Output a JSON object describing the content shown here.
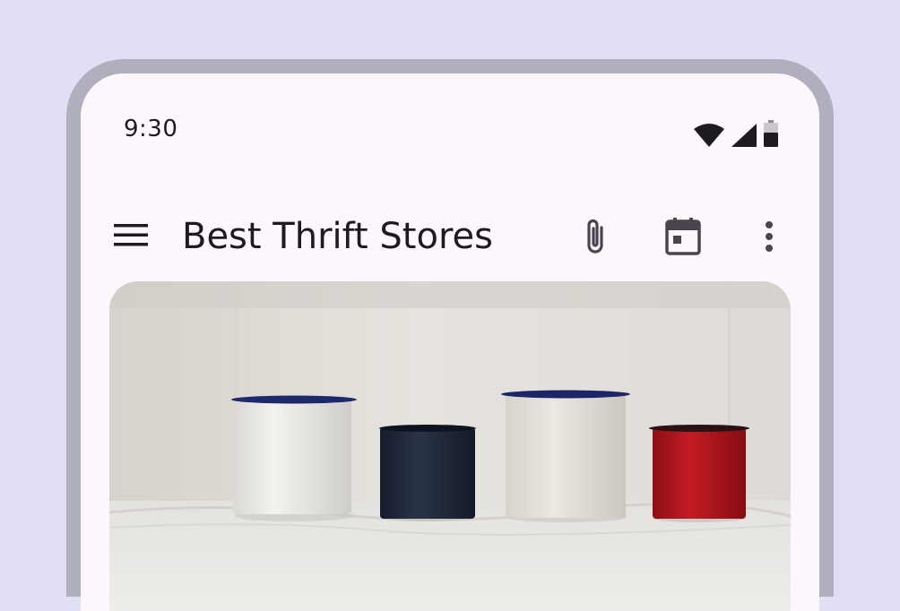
{
  "status_bar": {
    "time": "9:30",
    "icons": [
      "wifi-icon",
      "cellular-signal-icon",
      "battery-icon"
    ]
  },
  "top_app_bar": {
    "title": "Best Thrift Stores",
    "navigation_icon": "menu-icon",
    "actions": [
      "attach-icon",
      "calendar-icon",
      "more-vert-icon"
    ]
  },
  "content": {
    "image": "enamel-mugs-photo"
  },
  "colors": {
    "background": "#e1dff6",
    "frame": "#b0afbe",
    "surface": "#fdf6fd",
    "on_surface": "#1d1b20",
    "icon": "#49454f"
  }
}
